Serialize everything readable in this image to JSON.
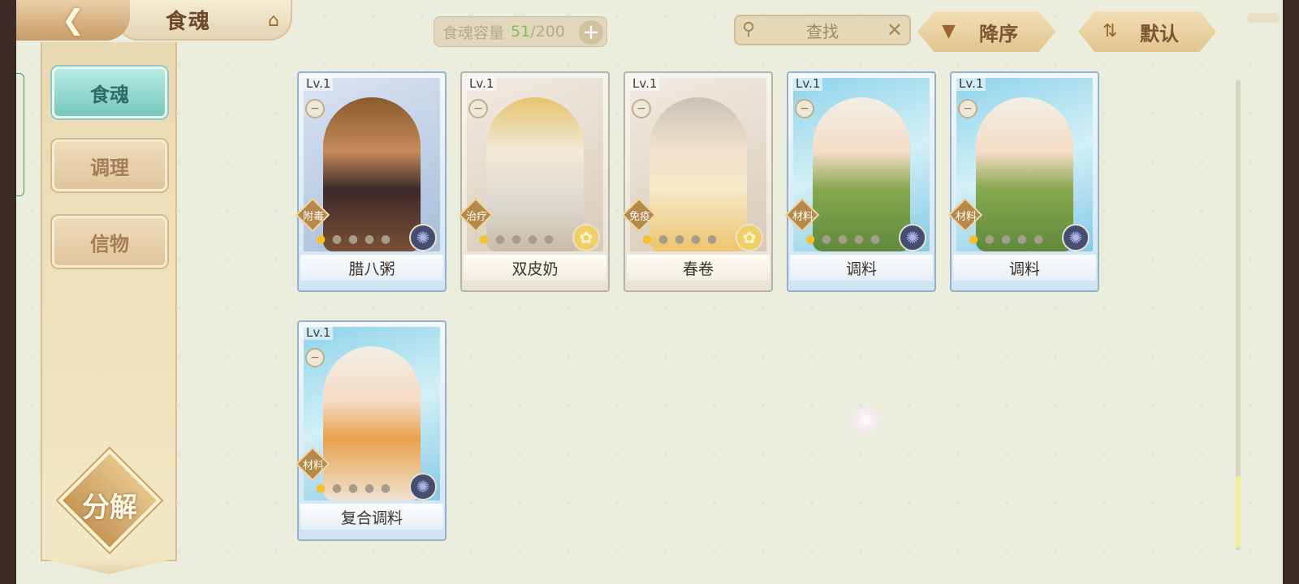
{
  "header": {
    "back_icon": "back-arrow-icon",
    "title": "食魂",
    "home_icon": "pavilion-icon"
  },
  "capacity": {
    "label": "食魂容量",
    "used": "51",
    "max": "/200",
    "add_label": "+"
  },
  "search": {
    "placeholder": "查找",
    "icon": "magnifier-icon",
    "clear_label": "✕"
  },
  "sort": {
    "order_label": "降序",
    "order_icon": "triangle-down-icon",
    "filter_label": "默认",
    "filter_icon": "sort-arrows-icon"
  },
  "sidebar": {
    "tabs": [
      {
        "label": "食魂",
        "active": true
      },
      {
        "label": "调理",
        "active": false
      },
      {
        "label": "信物",
        "active": false
      }
    ],
    "decompose_label": "分解"
  },
  "cards": [
    {
      "level": "Lv.1",
      "type": "附毒",
      "name": "腊八粥",
      "stars_on": 1,
      "element": "dark",
      "frame": "blue"
    },
    {
      "level": "Lv.1",
      "type": "治疗",
      "name": "双皮奶",
      "stars_on": 1,
      "element": "gold",
      "frame": "white"
    },
    {
      "level": "Lv.1",
      "type": "免疫",
      "name": "春卷",
      "stars_on": 1,
      "element": "gold",
      "frame": "white"
    },
    {
      "level": "Lv.1",
      "type": "材料",
      "name": "调料",
      "stars_on": 1,
      "element": "dark",
      "frame": "blue"
    },
    {
      "level": "Lv.1",
      "type": "材料",
      "name": "调料",
      "stars_on": 1,
      "element": "dark",
      "frame": "blue"
    },
    {
      "level": "Lv.1",
      "type": "材料",
      "name": "复合调料",
      "stars_on": 1,
      "element": "dark",
      "frame": "blue"
    }
  ],
  "colors": {
    "accent_green": "#7fbf4f",
    "tab_active": "#78c8bd",
    "gold": "#c59757"
  }
}
